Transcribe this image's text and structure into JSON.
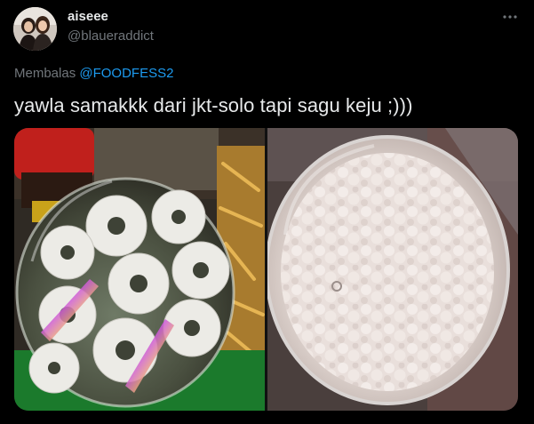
{
  "tweet": {
    "display_name": "aiseee",
    "handle": "@blaueraddict",
    "reply_prefix": "Membalas",
    "reply_mention": "@FOODFESS2",
    "text": "yawla samakkk dari jkt-solo tapi sagu keju ;)))"
  },
  "icons": {
    "more": "more-horizontal-icon"
  },
  "colors": {
    "background": "#000000",
    "primary_text": "#e7e9ea",
    "secondary_text": "#71767b",
    "link": "#1d9bf0"
  }
}
